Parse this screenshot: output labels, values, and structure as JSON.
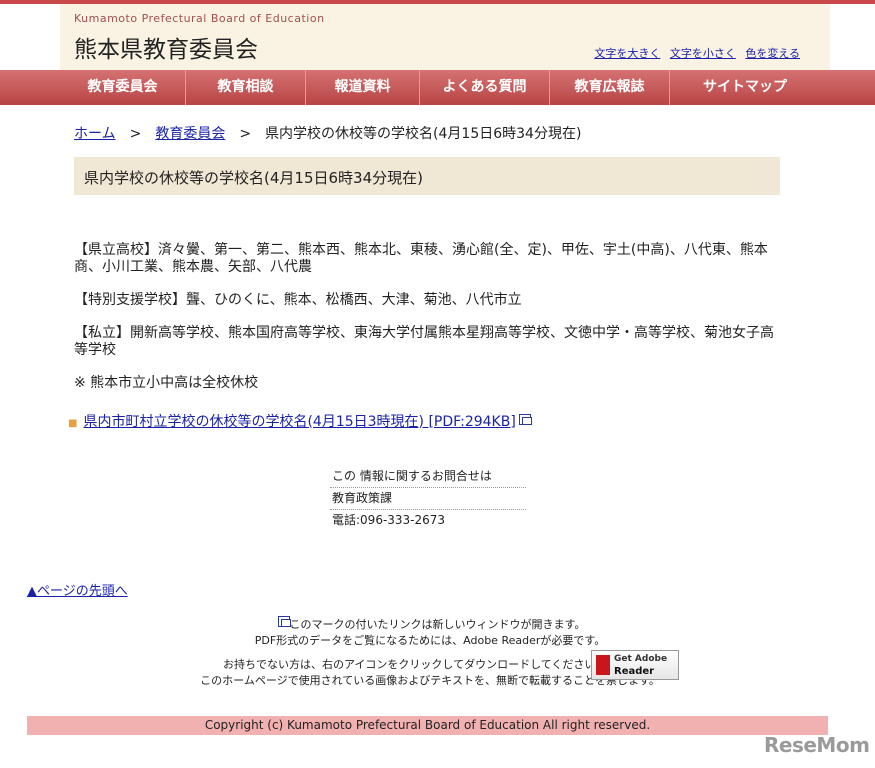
{
  "header": {
    "org_en": "Kumamoto Prefectural Board of Education",
    "org_jp": "熊本県教育委員会",
    "util_links": [
      "文字を大きく",
      "文字を小さく",
      "色を変える"
    ]
  },
  "nav": [
    {
      "label": "教育委員会",
      "width": 126
    },
    {
      "label": "教育相談",
      "width": 120
    },
    {
      "label": "報道資料",
      "width": 114
    },
    {
      "label": "よくある質問",
      "width": 130
    },
    {
      "label": "教育広報誌",
      "width": 120
    },
    {
      "label": "サイトマップ",
      "width": 150
    }
  ],
  "breadcrumb": {
    "home": "ホーム",
    "sep": ">",
    "parent": "教育委員会",
    "current": "県内学校の休校等の学校名(4月15日6時34分現在)"
  },
  "page_title": "県内学校の休校等の学校名(4月15日6時34分現在)",
  "content": {
    "p1": "【県立高校】済々黌、第一、第二、熊本西、熊本北、東稜、湧心館(全、定)、甲佐、宇土(中高)、八代東、熊本商、小川工業、熊本農、矢部、八代農",
    "p2": "【特別支援学校】聾、ひのくに、熊本、松橋西、大津、菊池、八代市立",
    "p3": "【私立】開新高等学校、熊本国府高等学校、東海大学付属熊本星翔高等学校、文徳中学・高等学校、菊池女子高等学校",
    "p4": "※ 熊本市立小中高は全校休校"
  },
  "pdf_link": "県内市町村立学校の休校等の学校名(4月15日3時現在) [PDF:294KB]",
  "contact": {
    "heading": "この 情報に関するお問合せは",
    "dept": "教育政策課",
    "phone": "電話:096-333-2673"
  },
  "page_top": "▲ページの先頭へ",
  "notes": {
    "newwin": "このマークの付いたリンクは新しいウィンドウが開きます。",
    "pdf_need": "PDF形式のデータをご覧になるためには、Adobe Readerが必要です。",
    "download": "お持ちでない方は、右のアイコンをクリックしてダウンロードしてください。(無料)",
    "copyright_notice": "このホームページで使用されている画像およびテキストを、無断で転載することを禁じます。"
  },
  "adobe_badge": {
    "line1": "Get Adobe",
    "line2": "Reader"
  },
  "copyright": "Copyright (c) Kumamoto Prefectural Board of Education All right reserved.",
  "watermark": "ReseMom"
}
